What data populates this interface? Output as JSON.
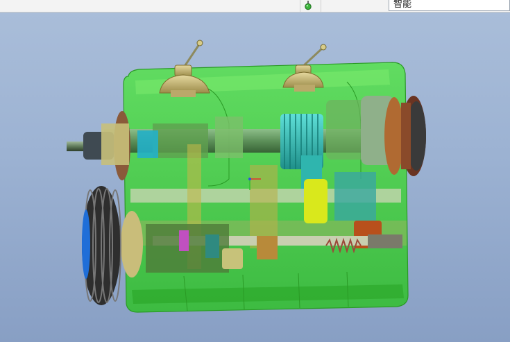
{
  "toolbar": {
    "filter_value": "智能",
    "status_icon": "green-light-icon"
  },
  "viewport": {
    "model": "gearbox-assembly-3d",
    "background_top": "#a9bdd9",
    "background_bottom": "#889fc4",
    "housing_color": "#3fd43a"
  }
}
